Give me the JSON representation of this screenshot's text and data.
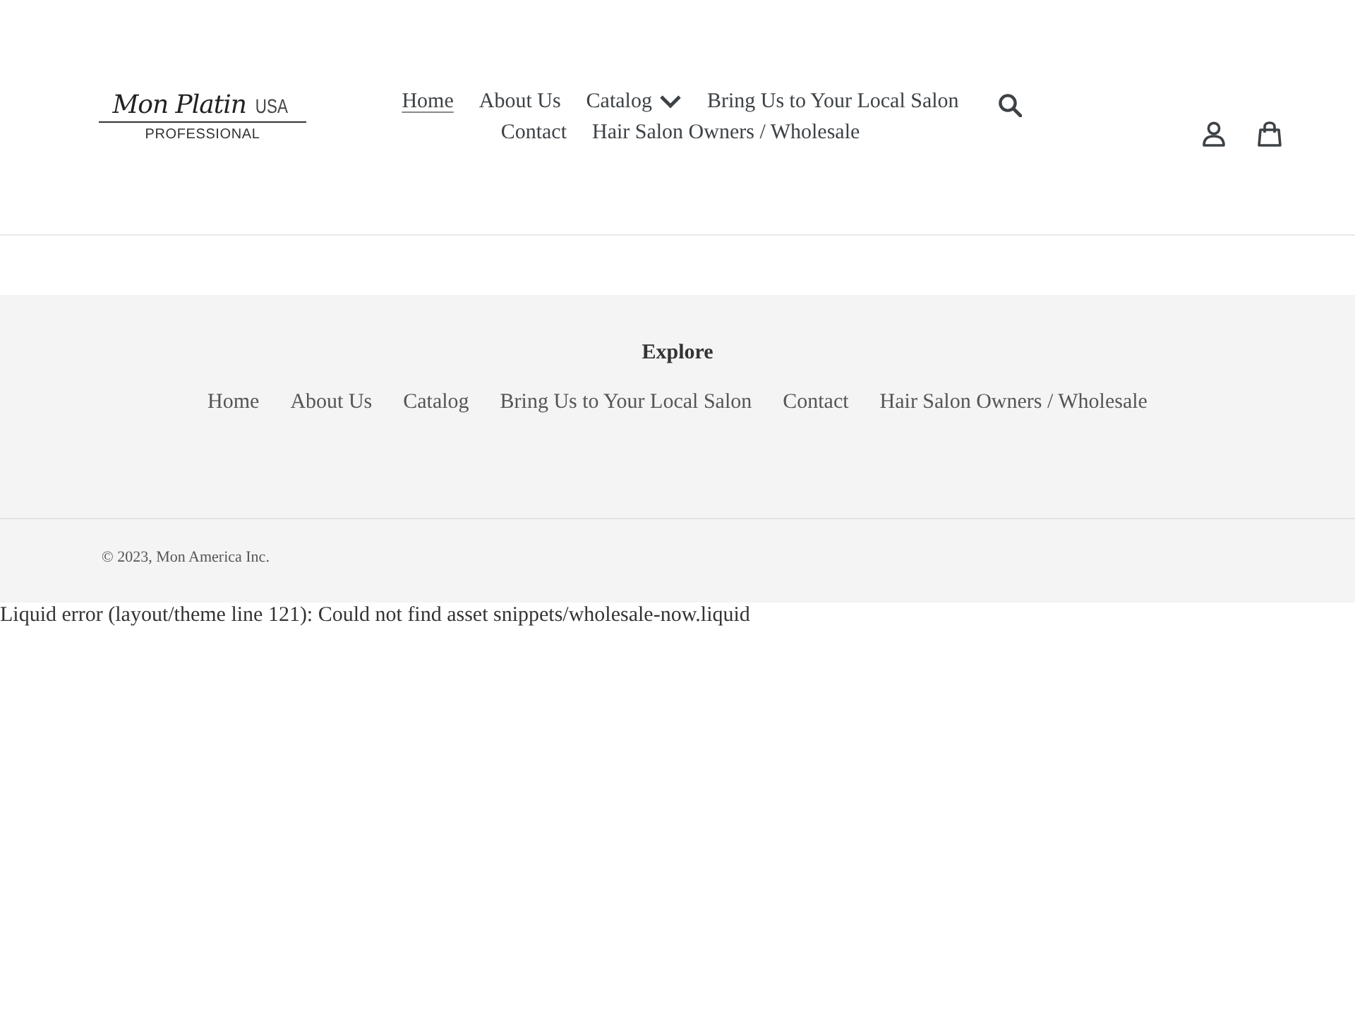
{
  "header": {
    "logo": {
      "script": "Mon Platin",
      "suffix": "USA",
      "tagline": "PROFESSIONAL"
    },
    "nav": [
      {
        "label": "Home",
        "selected": true,
        "dropdown": false
      },
      {
        "label": "About Us",
        "selected": false,
        "dropdown": false
      },
      {
        "label": "Catalog",
        "selected": false,
        "dropdown": true
      },
      {
        "label": "Bring Us to Your Local Salon",
        "selected": false,
        "dropdown": false
      },
      {
        "label": "Contact",
        "selected": false,
        "dropdown": false
      },
      {
        "label": "Hair Salon Owners / Wholesale",
        "selected": false,
        "dropdown": false
      }
    ]
  },
  "footer": {
    "heading": "Explore",
    "links": [
      "Home",
      "About Us",
      "Catalog",
      "Bring Us to Your Local Salon",
      "Contact",
      "Hair Salon Owners / Wholesale"
    ],
    "copyright": "© 2023, Mon America Inc."
  },
  "error_message": "Liquid error (layout/theme line 121): Could not find asset snippets/wholesale-now.liquid"
}
